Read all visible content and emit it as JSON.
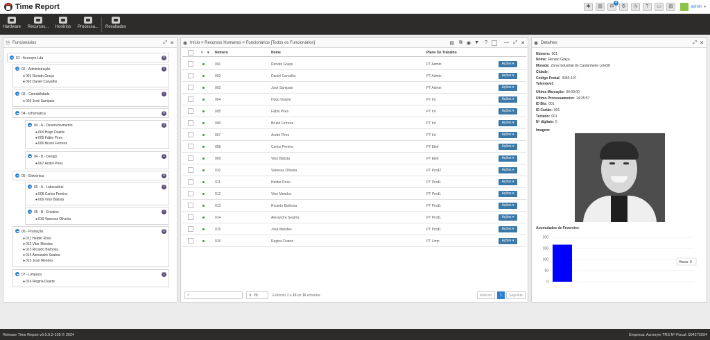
{
  "app": {
    "title": "Time Report",
    "user": "admin"
  },
  "ribbon": [
    "Hardware",
    "Recursos...",
    "Horários",
    "Processa...",
    "Resultados"
  ],
  "left_panel": {
    "title": "Funcionários"
  },
  "tree": {
    "root": {
      "label": "01 - Acronym Lda",
      "badge": "0"
    },
    "groups": [
      {
        "label": "02 - Administração",
        "badge": "2",
        "employees": [
          "001 Renato Graça",
          "002 Daniel Carvalho"
        ]
      },
      {
        "label": "03 - Contabilidade",
        "badge": "1",
        "employees": [
          "003 José Sampaio"
        ]
      },
      {
        "label": "04 - Informática",
        "badge": "0",
        "employees": []
      },
      {
        "label": "04 - A - Desenvolvimento",
        "badge": "3",
        "employees": [
          "004 Hugo Duarte",
          "005 Fábio Pires",
          "006 Bruno Ferreira"
        ]
      },
      {
        "label": "04 - B - Design",
        "badge": "1",
        "employees": [
          "007 André Pires"
        ]
      },
      {
        "label": "05 - Eletrónica",
        "badge": "0",
        "employees": []
      },
      {
        "label": "05 - A - Laboratório",
        "badge": "2",
        "employees": [
          "008 Carlos Pereira",
          "009 Vítor Batista"
        ]
      },
      {
        "label": "05 - B - Ensaios",
        "badge": "1",
        "employees": [
          "010 Vanessa Oliveira"
        ]
      },
      {
        "label": "06 - Produção",
        "badge": "5",
        "employees": [
          "011 Helder Roxo",
          "012 Vitor Mendes",
          "013 Ricardo Barbosa",
          "014 Alexandre Seabra",
          "015 José Mendes"
        ]
      },
      {
        "label": "07 - Limpeza",
        "badge": "1",
        "employees": [
          "016 Regina Duarte"
        ]
      }
    ]
  },
  "center_panel": {
    "title": "Início > Recursos Humanos > Funcionários [Todos os Funcionários]"
  },
  "table": {
    "headers": [
      "Número",
      "Nome",
      "Plano De Trabalho"
    ],
    "action_label": "Ações",
    "rows": [
      [
        "001",
        "Renato Graça",
        "PT Admin"
      ],
      [
        "002",
        "Daniel Carvalho",
        "PT Admin"
      ],
      [
        "003",
        "José Sampaio",
        "PT Admin"
      ],
      [
        "004",
        "Hugo Duarte",
        "PT Inf"
      ],
      [
        "005",
        "Fábio Pires",
        "PT Inf"
      ],
      [
        "006",
        "Bruno Ferreira",
        "PT Inf"
      ],
      [
        "007",
        "André Pires",
        "PT Inf"
      ],
      [
        "008",
        "Carlos Pereira",
        "PT Eletr"
      ],
      [
        "009",
        "Vitor Batista",
        "PT Eletr"
      ],
      [
        "010",
        "Vanessa Oliveira",
        "PT Prod2"
      ],
      [
        "011",
        "Helder Roxo",
        "PT Prod1"
      ],
      [
        "012",
        "Vitor Mendes",
        "PT Prod1"
      ],
      [
        "013",
        "Ricardo Barbosa",
        "PT Prod1"
      ],
      [
        "014",
        "Alexandre Seabra",
        "PT Prod1"
      ],
      [
        "015",
        "José Mendes",
        "PT Prod1"
      ],
      [
        "016",
        "Regina Duarte",
        "PT Limp"
      ]
    ]
  },
  "pagination": {
    "page_size": "20",
    "info_prefix": "Exibindo",
    "info_from": "1",
    "info_mid": "a",
    "info_to": "16",
    "info_of": "de",
    "info_total": "16",
    "info_suffix": "entradas",
    "prev": "Anterior",
    "current": "1",
    "next": "Seguinte"
  },
  "details": {
    "title": "Detalhes",
    "fields": [
      {
        "label": "Número:",
        "value": "001"
      },
      {
        "label": "Nome:",
        "value": "Renato Graça"
      },
      {
        "label": "Morada:",
        "value": "Zona Industrial de Cantanhede Lote58"
      },
      {
        "label": "Cidade:",
        "value": ""
      },
      {
        "label": "Código Postal:",
        "value": "3060-197"
      },
      {
        "label": "Telemóvel:",
        "value": ""
      },
      {
        "label": "Ultima Marcação:",
        "value": "00:00:00"
      },
      {
        "label": "Ultimo Processamento:",
        "value": "14:25:57"
      },
      {
        "label": "ID Bio:",
        "value": "001"
      },
      {
        "label": "ID Cartão:",
        "value": "001"
      },
      {
        "label": "Teclado:",
        "value": "001"
      },
      {
        "label": "Nº digitais:",
        "value": "0"
      },
      {
        "label": "Imagem:",
        "value": ""
      }
    ],
    "chart_title": "Acumulados de Fevereiro:"
  },
  "chart_data": {
    "type": "bar",
    "categories": [
      ""
    ],
    "values": [
      167
    ],
    "ylim": [
      0,
      200
    ],
    "yticks": [
      "200",
      "150",
      "100",
      "50",
      "0"
    ],
    "legend": "Horas: 0",
    "bar_color": "#0000ff"
  },
  "footer": {
    "left": "Release Time Report v6.0.0.2-195 © 2024",
    "right": "Empresa: Acronym TRS Nº Fiscal: 504272594"
  }
}
